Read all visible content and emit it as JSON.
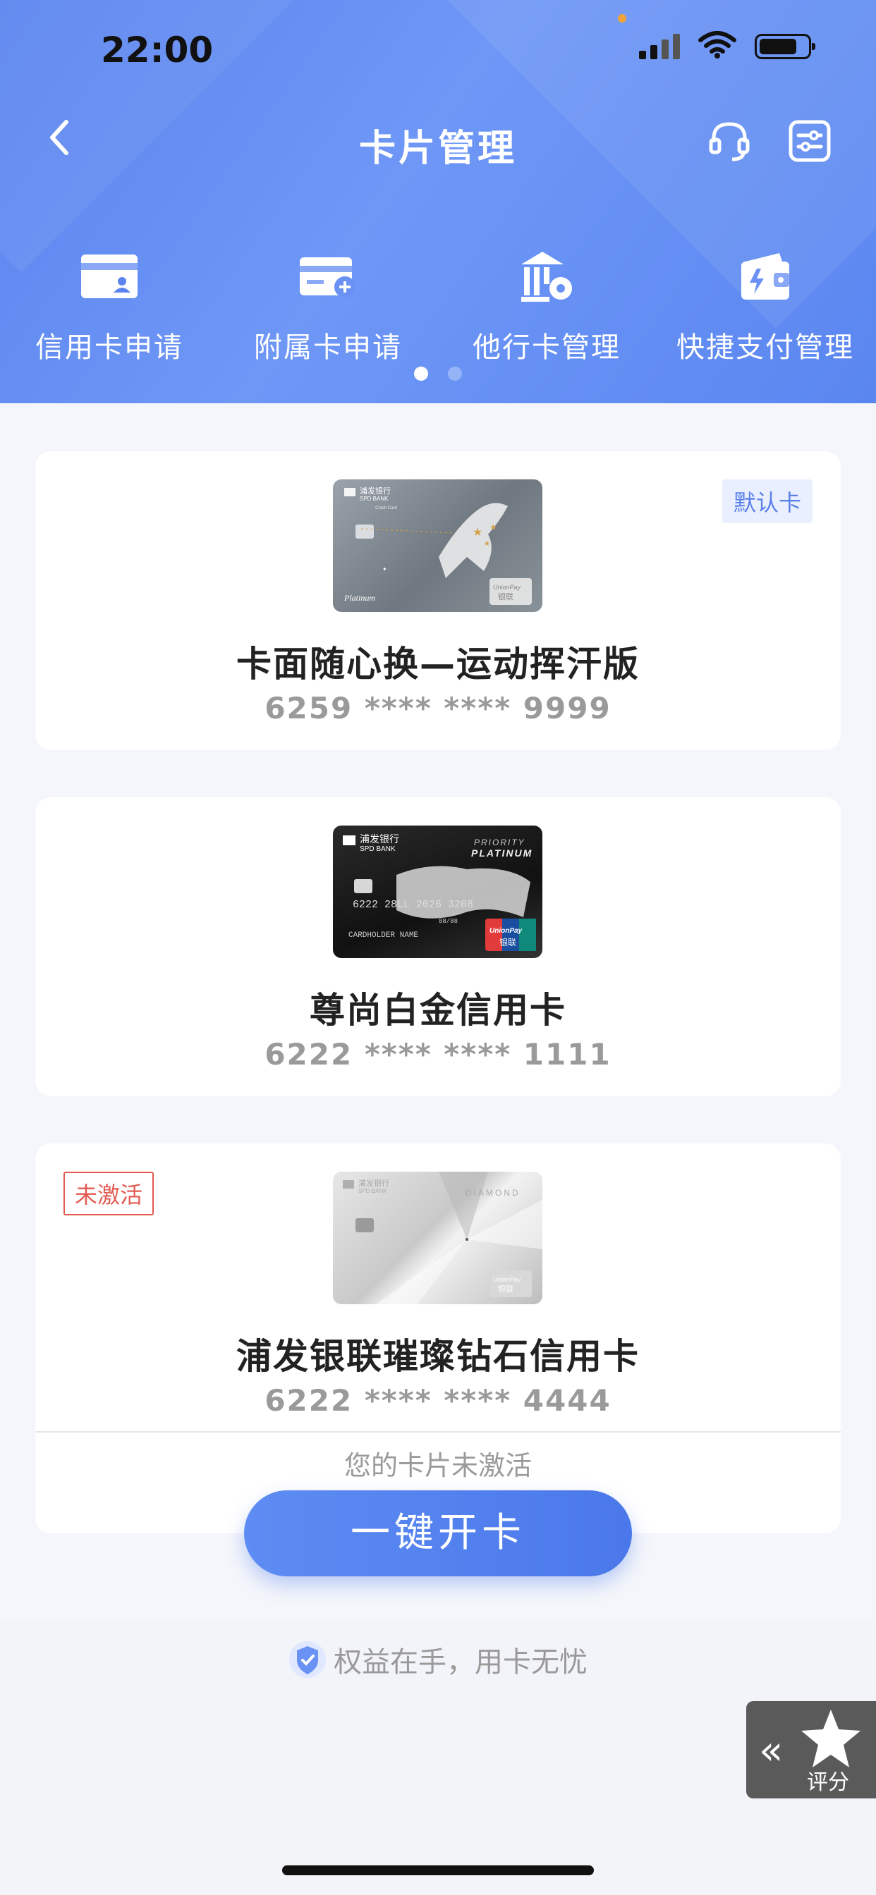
{
  "status_bar": {
    "time": "22:00"
  },
  "nav": {
    "title": "卡片管理"
  },
  "quick_actions": [
    {
      "label": "信用卡申请",
      "icon": "credit-card-user-icon"
    },
    {
      "label": "附属卡申请",
      "icon": "credit-card-plus-icon"
    },
    {
      "label": "他行卡管理",
      "icon": "bank-gear-icon"
    },
    {
      "label": "快捷支付管理",
      "icon": "wallet-lightning-icon"
    }
  ],
  "cards": [
    {
      "name": "卡面随心换—运动挥汗版",
      "number": "6259 **** **** 9999",
      "badge": "默认卡"
    },
    {
      "name": "尊尚白金信用卡",
      "number": "6222 **** **** 1111"
    },
    {
      "name": "浦发银联璀璨钻石信用卡",
      "number": "6222 **** **** 4444",
      "badge": "未激活",
      "status_message": "您的卡片未激活"
    }
  ],
  "card_images": {
    "card1": {
      "bank": "浦发银行",
      "bank_en": "SPD BANK",
      "sub": "Credit Card",
      "tier": "Platinum",
      "network": "UnionPay",
      "network_cn": "银联"
    },
    "card2": {
      "bank": "浦发银行",
      "bank_en": "SPD BANK",
      "line1": "PRIORITY",
      "line2": "PLATINUM",
      "number": "6222 28LL 2026 3208",
      "expiry": "88/88",
      "holder": "CARDHOLDER NAME",
      "network": "UnionPay",
      "network_cn": "银联"
    },
    "card3": {
      "bank": "浦发银行",
      "bank_en": "SPD BANK",
      "tier": "DIAMOND",
      "network": "UnionPay",
      "network_cn": "银联"
    }
  },
  "activate_button": {
    "label": "一键开卡"
  },
  "footer": {
    "note": "权益在手，用卡无忧"
  },
  "rating_widget": {
    "label": "评分",
    "arrows": "«"
  },
  "colors": {
    "header_blue": "#6a92f4",
    "accent_blue": "#4a78ea",
    "inactive_red": "#e25a50"
  }
}
